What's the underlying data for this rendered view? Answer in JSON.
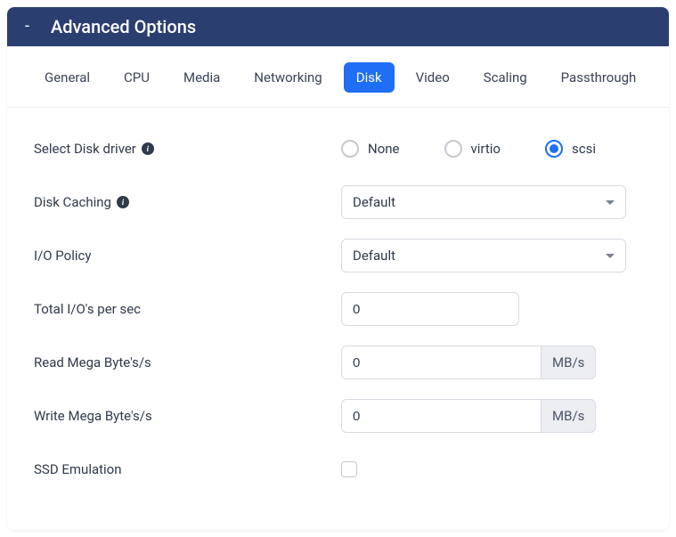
{
  "header": {
    "collapse_symbol": "-",
    "title": "Advanced Options"
  },
  "tabs": [
    {
      "label": "General",
      "active": false
    },
    {
      "label": "CPU",
      "active": false
    },
    {
      "label": "Media",
      "active": false
    },
    {
      "label": "Networking",
      "active": false
    },
    {
      "label": "Disk",
      "active": true
    },
    {
      "label": "Video",
      "active": false
    },
    {
      "label": "Scaling",
      "active": false
    },
    {
      "label": "Passthrough",
      "active": false
    }
  ],
  "form": {
    "disk_driver": {
      "label": "Select Disk driver",
      "options": [
        {
          "label": "None",
          "selected": false
        },
        {
          "label": "virtio",
          "selected": false
        },
        {
          "label": "scsi",
          "selected": true
        }
      ]
    },
    "disk_caching": {
      "label": "Disk Caching",
      "value": "Default"
    },
    "io_policy": {
      "label": "I/O Policy",
      "value": "Default"
    },
    "total_iops": {
      "label": "Total I/O's per sec",
      "value": "0"
    },
    "read_mbs": {
      "label": "Read Mega Byte's/s",
      "value": "0",
      "suffix": "MB/s"
    },
    "write_mbs": {
      "label": "Write Mega Byte's/s",
      "value": "0",
      "suffix": "MB/s"
    },
    "ssd_emulation": {
      "label": "SSD Emulation",
      "checked": false
    }
  }
}
